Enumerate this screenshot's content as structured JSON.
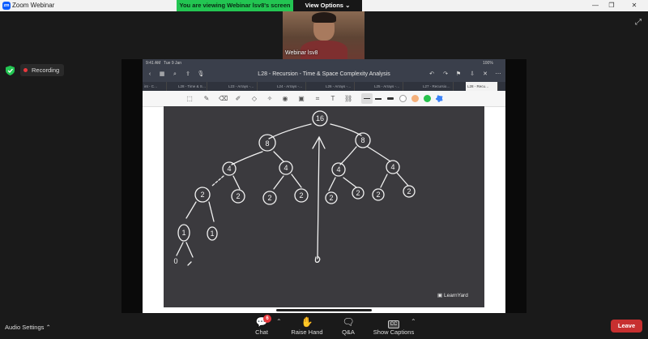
{
  "window": {
    "app_title": "Zoom Webinar",
    "app_logo": "zm",
    "share_banner": "You are viewing Webinar lsv8's screen",
    "view_options": "View Options",
    "controls": {
      "minimize": "—",
      "restore": "❐",
      "close": "✕"
    }
  },
  "video": {
    "name": "Webinar lsv8"
  },
  "recording": {
    "label": "Recording",
    "dot_color": "#e8383d"
  },
  "shared": {
    "status_time": "9:41 AM",
    "status_date": "Tue 9 Jan",
    "battery": "100%",
    "doc_title": "L28 - Recursion - Time & Space Complexity Analysis",
    "tabs": [
      "int - C…",
      "L28 - Time & S…",
      "L23 - Arrays -…",
      "L24 - Arrays -…",
      "L26 - Arrays -…",
      "L25 - Arrays -…",
      "L27 - Recursio…",
      "L28 - Recu…"
    ],
    "brand": "LearnYard",
    "palette": [
      "#222222",
      "#ffffff",
      "#f5b07a",
      "#f5b07a",
      "#27c24c",
      "#3b82f6"
    ]
  },
  "tree": {
    "root": "16",
    "level1": [
      "8",
      "8"
    ],
    "level2": [
      "4",
      "4",
      "4",
      "4"
    ],
    "level3": [
      "2",
      "2",
      "2",
      "2",
      "2",
      "2",
      "2",
      "2"
    ],
    "level4": [
      "1",
      "1"
    ],
    "level5": [
      "0"
    ]
  },
  "bottom": {
    "audio_settings": "Audio Settings",
    "chat": "Chat",
    "chat_badge": "6",
    "raise_hand": "Raise Hand",
    "qa": "Q&A",
    "show_captions": "Show Captions",
    "captions_icon": "CC",
    "leave": "Leave"
  },
  "colors": {
    "banner": "#23c552",
    "leave": "#c73030",
    "board": "#3b3a3e"
  }
}
